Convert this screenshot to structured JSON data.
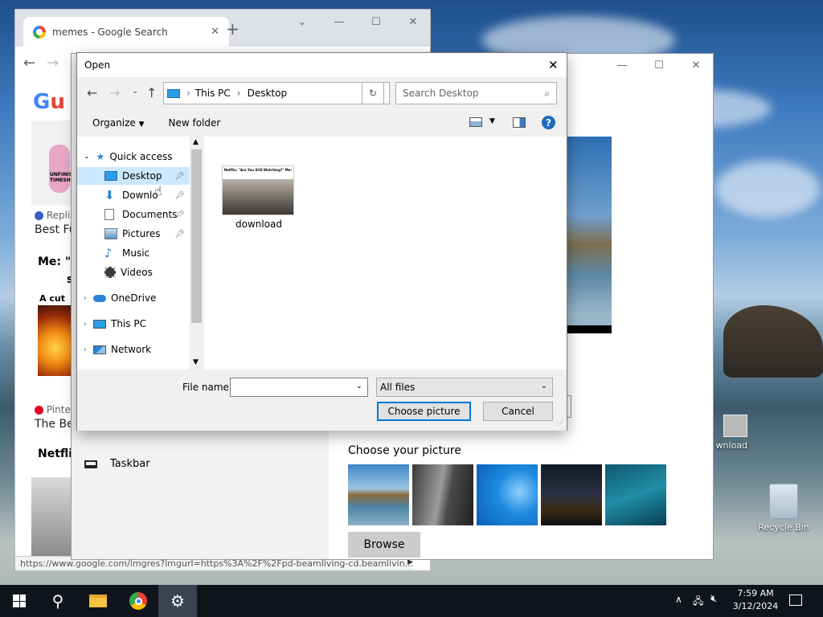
{
  "desktop": {
    "icons": [
      {
        "label": "Recycle Bin",
        "icon": "recycle-bin-icon"
      },
      {
        "label": "wnload",
        "icon": "image-file-icon"
      }
    ]
  },
  "chrome": {
    "tab_title": "memes - Google Search",
    "new_tab_symbol": "+",
    "status_url": "https://www.google.com/imgres?imgurl=https%3A%2F%2Fpd-beamliving-cd.beamlivin...",
    "page": {
      "card1_source": "Repli",
      "card1_title": "Best Fu",
      "card2_heading": "Me: \"",
      "card2_heading2": "s",
      "card2_caption": "A cut",
      "card2_source": "Pinter",
      "card2_title": "The Be",
      "card3_heading": "Netfli",
      "meme_text": "UNFINISHED TIMESHE"
    }
  },
  "settings": {
    "sidebar_item": "Taskbar",
    "choose_label": "Choose your picture",
    "browse_label": "Browse"
  },
  "dialog": {
    "title": "Open",
    "breadcrumb": [
      "This PC",
      "Desktop"
    ],
    "search_placeholder": "Search Desktop",
    "organize_label": "Organize",
    "new_folder_label": "New folder",
    "help_symbol": "?",
    "nav_items": [
      {
        "label": "Quick access",
        "icon": "star-icon",
        "pinned": false
      },
      {
        "label": "Desktop",
        "icon": "desktop-folder-icon",
        "pinned": true,
        "selected": true
      },
      {
        "label": "Downlo",
        "icon": "downloads-icon",
        "pinned": true
      },
      {
        "label": "Documents",
        "icon": "documents-icon",
        "pinned": true
      },
      {
        "label": "Pictures",
        "icon": "pictures-icon",
        "pinned": true
      },
      {
        "label": "Music",
        "icon": "music-icon",
        "pinned": false
      },
      {
        "label": "Videos",
        "icon": "videos-icon",
        "pinned": false
      },
      {
        "label": "OneDrive",
        "icon": "onedrive-icon",
        "pinned": false
      },
      {
        "label": "This PC",
        "icon": "this-pc-icon",
        "pinned": false
      },
      {
        "label": "Network",
        "icon": "network-icon",
        "pinned": false
      }
    ],
    "file": {
      "name": "download",
      "thumb_caption": "Netflix: \"Are You Still Watching?\" Me:"
    },
    "file_name_label": "File name:",
    "file_name_value": "",
    "file_type": "All files",
    "choose_button": "Choose picture",
    "cancel_button": "Cancel"
  },
  "taskbar": {
    "time": "7:59 AM",
    "date": "3/12/2024"
  },
  "colors": {
    "selection": "#cce8ff",
    "accent": "#0078d7",
    "taskbar": "#10151c"
  }
}
